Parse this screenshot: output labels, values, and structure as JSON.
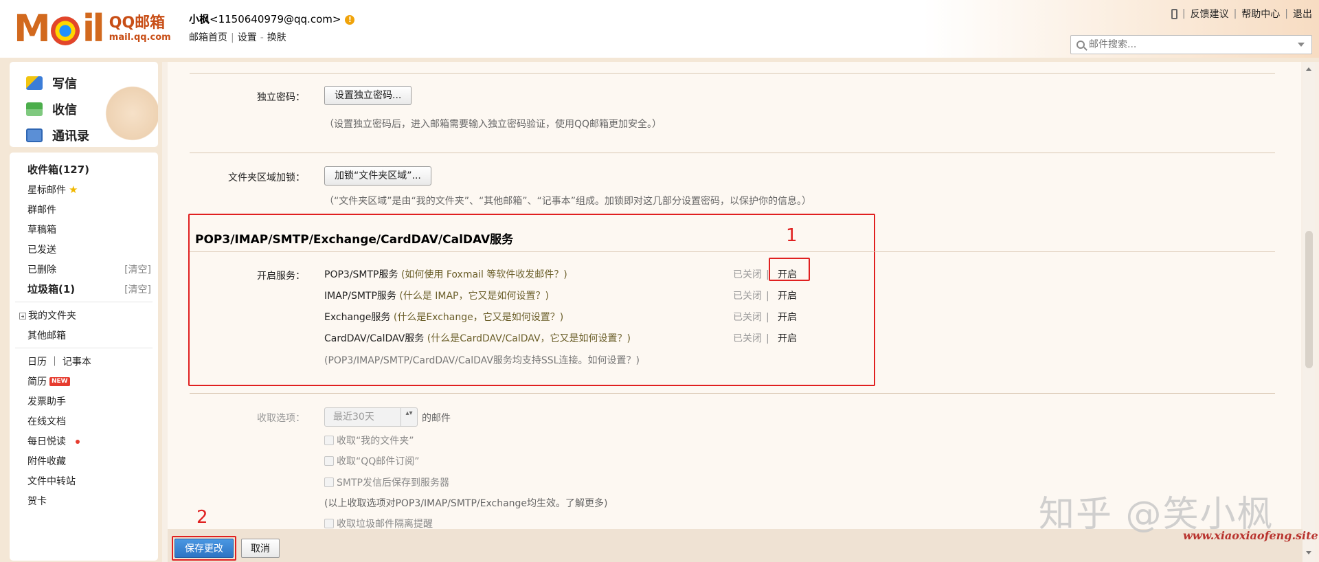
{
  "header": {
    "logo_text": "Mail",
    "logo_sub": "QQ邮箱",
    "logo_domain": "mail.qq.com",
    "username": "小枫",
    "email": "<1150640979@qq.com>",
    "warn_glyph": "!",
    "nav": [
      "邮箱首页",
      "设置",
      "换肤"
    ],
    "nav_sep1": "|",
    "nav_sep2": "-",
    "toplinks": [
      "反馈建议",
      "帮助中心",
      "退出"
    ],
    "toplink_sep": "|",
    "search_placeholder": "邮件搜索..."
  },
  "sidebar": {
    "top_buttons": [
      "写信",
      "收信",
      "通讯录"
    ],
    "items": [
      {
        "label": "收件箱(127)",
        "bold": true
      },
      {
        "label": "星标邮件"
      },
      {
        "label": "群邮件"
      },
      {
        "label": "草稿箱"
      },
      {
        "label": "已发送"
      },
      {
        "label": "已删除",
        "action": "[清空]"
      },
      {
        "label": "垃圾箱(1)",
        "bold": true,
        "action": "[清空]"
      }
    ],
    "folders": [
      "我的文件夹",
      "其他邮箱"
    ],
    "tools_line": "日历 ｜ 记事本",
    "tools": [
      "简历",
      "发票助手",
      "在线文档",
      "每日悦读",
      "附件收藏",
      "文件中转站",
      "贺卡"
    ],
    "new_badge": "NEW",
    "star_glyph": "★"
  },
  "content": {
    "pw_label": "独立密码：",
    "pw_button": "设置独立密码...",
    "pw_hint": "（设置独立密码后，进入邮箱需要输入独立密码验证，使用QQ邮箱更加安全。）",
    "folder_label": "文件夹区域加锁：",
    "folder_button": "加锁“文件夹区域”...",
    "folder_hint": "（“文件夹区域”是由“我的文件夹”、“其他邮箱”、“记事本”组成。加锁即对这几部分设置密码，以保护你的信息。）",
    "section_title": "POP3/IMAP/SMTP/Exchange/CardDAV/CalDAV服务",
    "service_label": "开启服务：",
    "services": [
      {
        "name": "POP3/SMTP服务",
        "help": "(如何使用 Foxmail 等软件收发邮件？)",
        "status": "已关闭",
        "action": "开启"
      },
      {
        "name": "IMAP/SMTP服务",
        "help": "(什么是 IMAP，它又是如何设置？)",
        "status": "已关闭",
        "action": "开启"
      },
      {
        "name": "Exchange服务",
        "help": "(什么是Exchange，它又是如何设置？)",
        "status": "已关闭",
        "action": "开启"
      },
      {
        "name": "CardDAV/CalDAV服务",
        "help": "(什么是CardDAV/CalDAV，它又是如何设置？)",
        "status": "已关闭",
        "action": "开启"
      }
    ],
    "status_sep": "|",
    "ssl_note": "(POP3/IMAP/SMTP/CardDAV/CalDAV服务均支持SSL连接。如何设置？)",
    "recv_label": "收取选项：",
    "recv_select": "最近30天",
    "recv_suffix": "的邮件",
    "checks": [
      "收取“我的文件夹”",
      "收取“QQ邮件订阅”",
      "SMTP发信后保存到服务器"
    ],
    "recv_note": "(以上收取选项对POP3/IMAP/SMTP/Exchange均生效。了解更多)",
    "check_last": "收取垃圾邮件隔离提醒",
    "annot_1": "1",
    "annot_2": "2",
    "spin_glyph": "▴▾"
  },
  "footer": {
    "save": "保存更改",
    "cancel": "取消"
  },
  "watermark": {
    "text": "知乎 @笑小枫",
    "site": "www.xiaoxiaofeng.site"
  },
  "colors": {
    "annotation_red": "#e02020",
    "primary_blue": "#2d74c4",
    "logo_orange": "#d2691e"
  }
}
